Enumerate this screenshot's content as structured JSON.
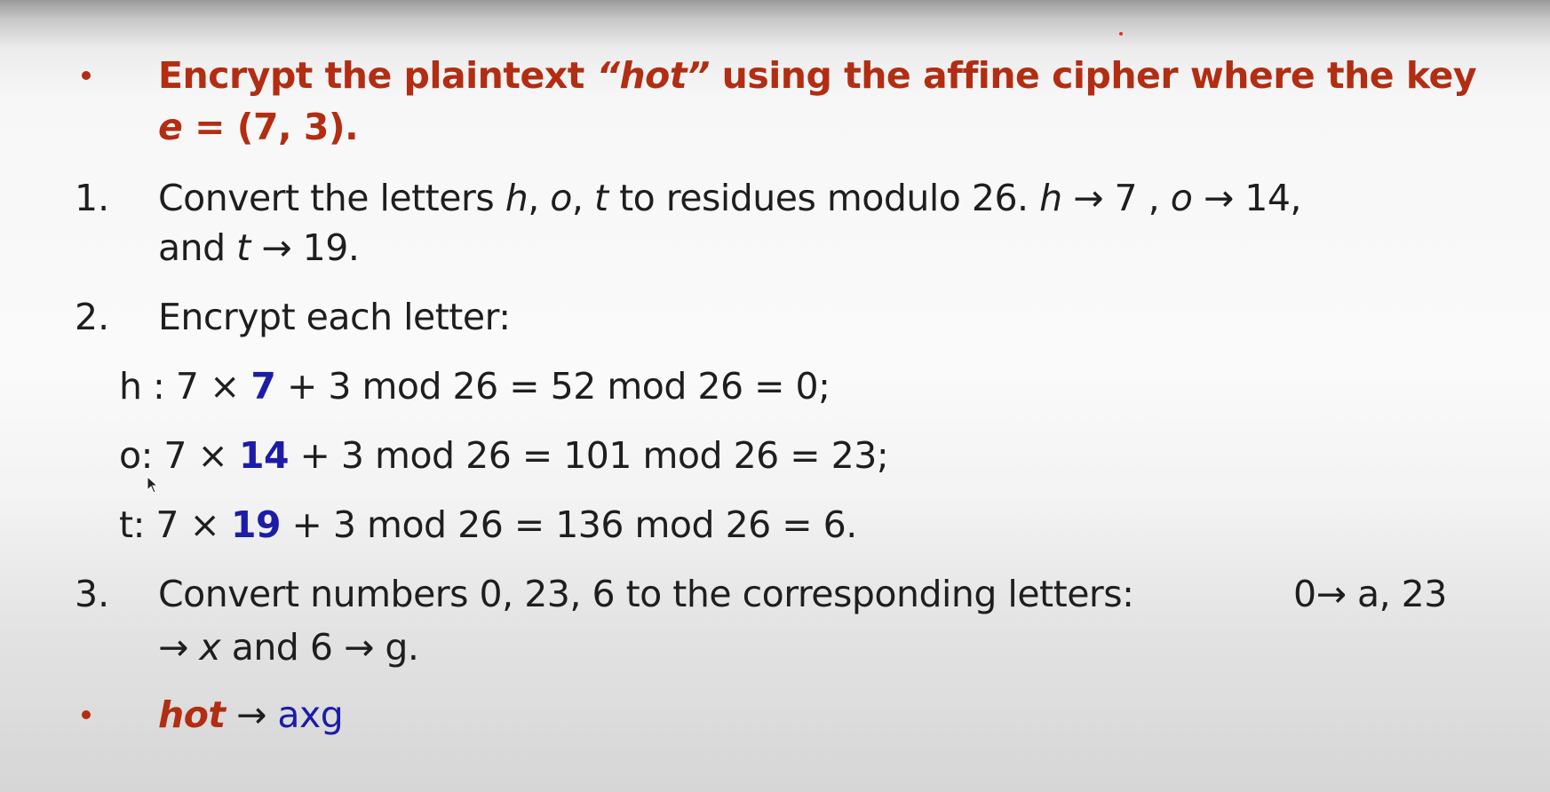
{
  "intro": {
    "pre": "Encrypt the plaintext ",
    "word": "“hot”",
    "post": " using the affine cipher where the key",
    "key_var": "e",
    "key_val": " = (7, 3)."
  },
  "step1": {
    "number": "1.",
    "pre": "Convert the letters ",
    "h": "h",
    "sep1": ", ",
    "o": "o",
    "sep2": ", ",
    "t": "t",
    "mid": " to residues modulo 26. ",
    "h2": "h",
    "map_h": " → 7  , ",
    "o2": "o",
    "map_o": " → 14,",
    "and": "and  ",
    "t2": "t",
    "map_t": " → 19."
  },
  "step2": {
    "number": "2.",
    "text": "Encrypt each letter:",
    "rows": [
      {
        "label": "h :  7 × ",
        "val": "7",
        "rest": " + 3 mod 26 = 52 mod 26 = 0;"
      },
      {
        "label": "o:  7 × ",
        "val": "14",
        "rest": " + 3 mod 26 = 101 mod 26 = 23;"
      },
      {
        "label": "t: 7 × ",
        "val": "19",
        "rest": " + 3 mod 26 = 136 mod 26 = 6."
      }
    ]
  },
  "step3": {
    "number": "3.",
    "text": "Convert numbers 0, 23, 6 to the corresponding letters:",
    "map1": "0→ a, 23",
    "arrow": "→ ",
    "x": "x",
    "rest": "  and 6  → g."
  },
  "result": {
    "word": "hot",
    "arrow": "  → ",
    "cipher": "axg"
  },
  "colors": {
    "red": "#b22d12",
    "blue": "#1c1ca8"
  }
}
